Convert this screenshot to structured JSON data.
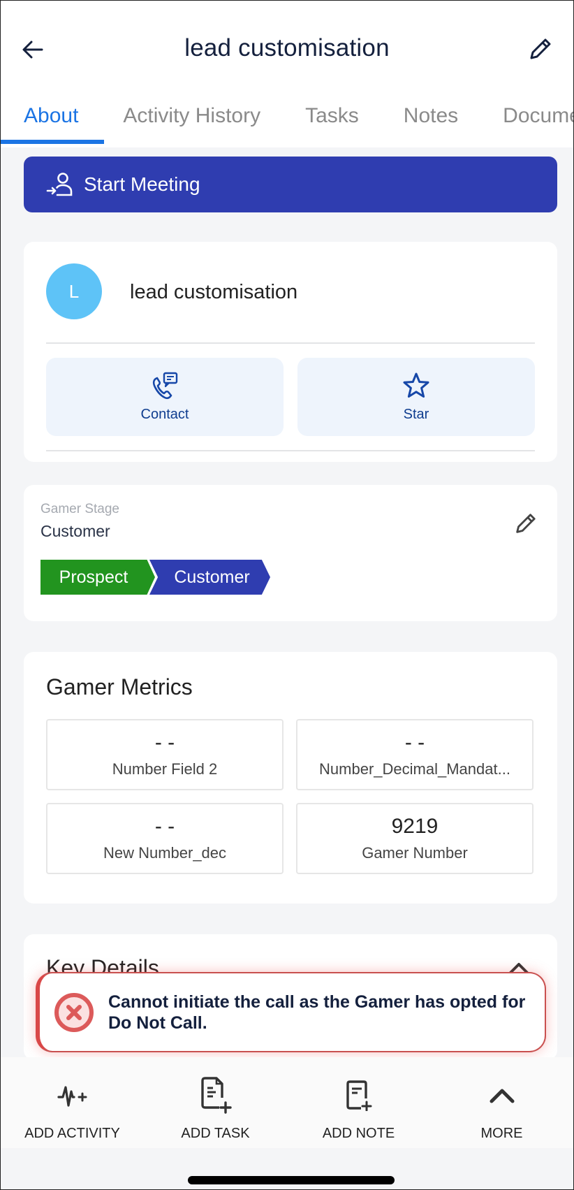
{
  "header": {
    "title": "lead customisation",
    "back_icon": "arrow-left-icon",
    "edit_icon": "pencil-icon"
  },
  "tabs": [
    {
      "label": "About",
      "active": true
    },
    {
      "label": "Activity History",
      "active": false
    },
    {
      "label": "Tasks",
      "active": false
    },
    {
      "label": "Notes",
      "active": false
    },
    {
      "label": "Documents",
      "active": false
    }
  ],
  "start_meeting": {
    "label": "Start Meeting",
    "icon": "user-enter-icon"
  },
  "profile": {
    "avatar_initial": "L",
    "name": "lead customisation",
    "actions": [
      {
        "label": "Contact",
        "icon": "phone-message-icon"
      },
      {
        "label": "Star",
        "icon": "star-icon"
      }
    ]
  },
  "stage": {
    "label": "Gamer Stage",
    "value": "Customer",
    "steps": [
      "Prospect",
      "Customer"
    ]
  },
  "metrics": {
    "title": "Gamer Metrics",
    "items": [
      {
        "value": "- -",
        "name": "Number Field 2"
      },
      {
        "value": "- -",
        "name": "Number_Decimal_Mandat..."
      },
      {
        "value": "- -",
        "name": "New Number_dec"
      },
      {
        "value": "9219",
        "name": "Gamer Number"
      }
    ]
  },
  "key_details": {
    "title": "Key Details"
  },
  "toast": {
    "message": "Cannot initiate the call as the Gamer has opted for Do Not Call.",
    "icon": "error-circle-icon"
  },
  "bottom_bar": [
    {
      "label": "ADD ACTIVITY",
      "icon": "activity-plus-icon"
    },
    {
      "label": "ADD TASK",
      "icon": "task-plus-icon"
    },
    {
      "label": "ADD NOTE",
      "icon": "note-plus-icon"
    },
    {
      "label": "MORE",
      "icon": "chevron-up-icon"
    }
  ],
  "colors": {
    "primary": "#2f3db0",
    "tab_active": "#1b74e4",
    "stage_prospect": "#22941f",
    "avatar": "#5ec3f7",
    "error": "#d94848"
  }
}
